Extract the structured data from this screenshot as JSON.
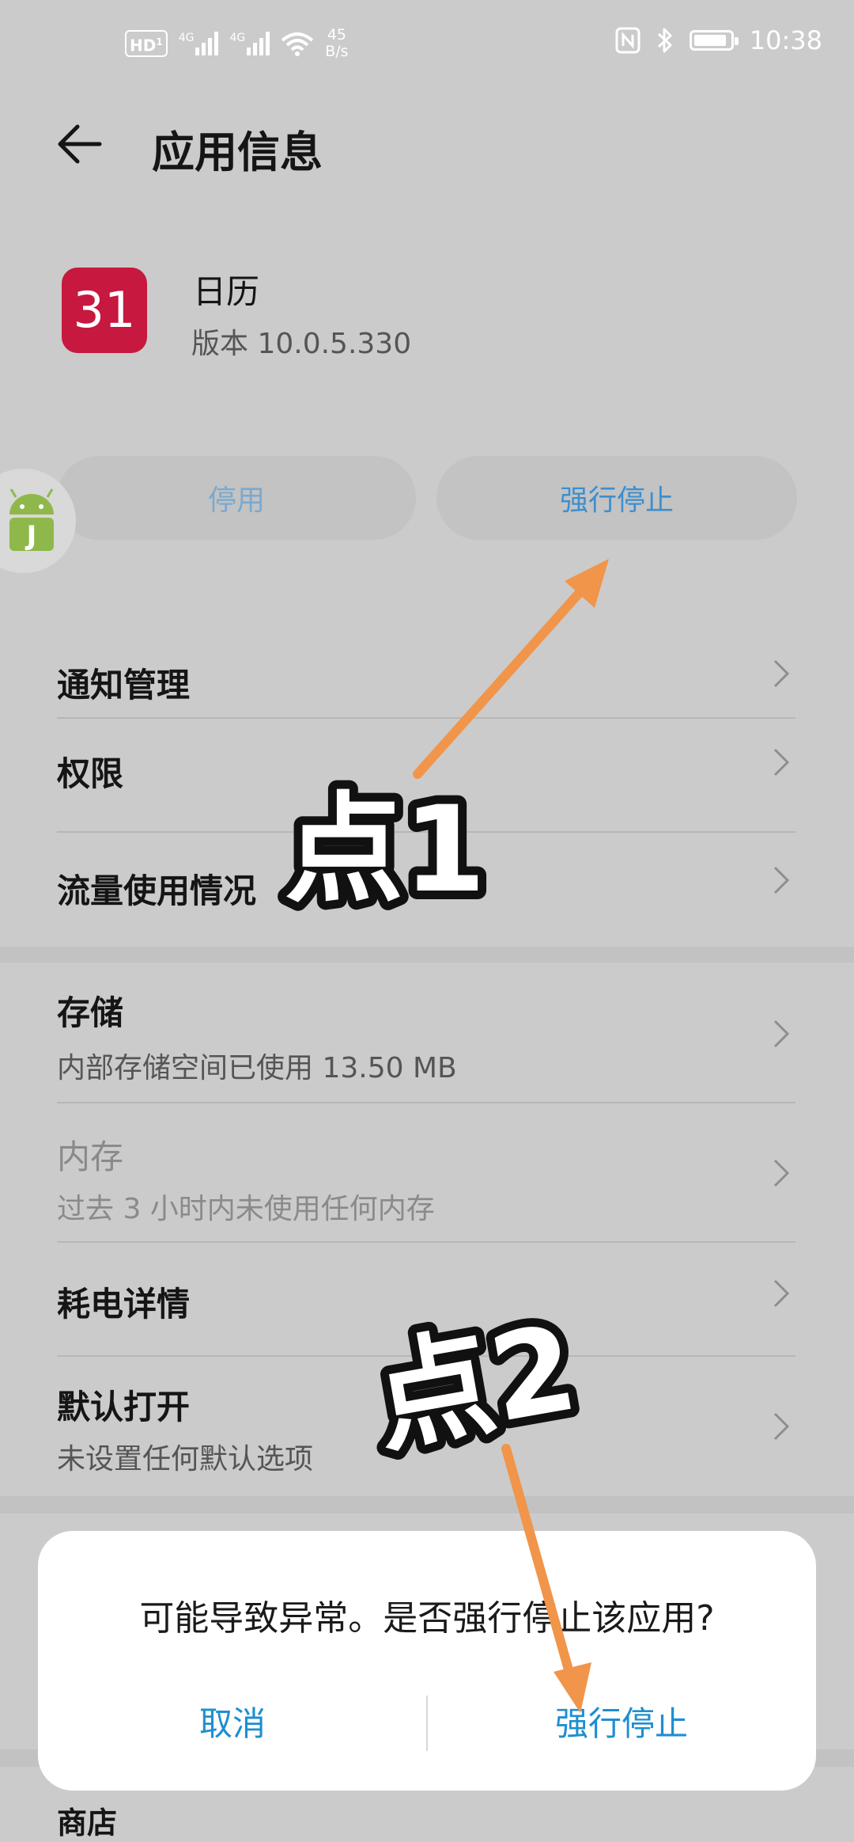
{
  "status_bar": {
    "hd_label": "HD",
    "sim_1_label": "1",
    "network_1": "4G",
    "network_2": "4G",
    "speed_value": "45",
    "speed_unit": "B/s",
    "time": "10:38",
    "icons": [
      "nfc-icon",
      "bluetooth-icon",
      "battery-icon",
      "wifi-icon"
    ],
    "battery_level": 0.9
  },
  "header": {
    "back_icon": "arrow-left-icon",
    "title": "应用信息"
  },
  "app": {
    "icon_text": "31",
    "name": "日历",
    "version": "版本 10.0.5.330",
    "icon_color": "#c7183f"
  },
  "actions": {
    "disable_label": "停用",
    "force_stop_label": "强行停止"
  },
  "list_group_1": [
    {
      "title": "通知管理"
    },
    {
      "title": "权限"
    },
    {
      "title": "流量使用情况"
    }
  ],
  "list_group_2": [
    {
      "title": "存储",
      "subtitle": "内部存储空间已使用 13.50 MB"
    },
    {
      "title": "内存",
      "subtitle": "过去 3 小时内未使用任何内存"
    },
    {
      "title": "耗电详情"
    },
    {
      "title": "默认打开",
      "subtitle": "未设置任何默认选项"
    }
  ],
  "partial_row": {
    "title": "商店"
  },
  "dialog": {
    "message": "可能导致异常。是否强行停止该应用?",
    "cancel_label": "取消",
    "confirm_label": "强行停止"
  },
  "annotations": {
    "step_1": "点1",
    "step_2": "点2",
    "arrow_color": "#f0954a"
  },
  "colors": {
    "accent": "#1e8fd0",
    "background": "#cbcbcb"
  }
}
